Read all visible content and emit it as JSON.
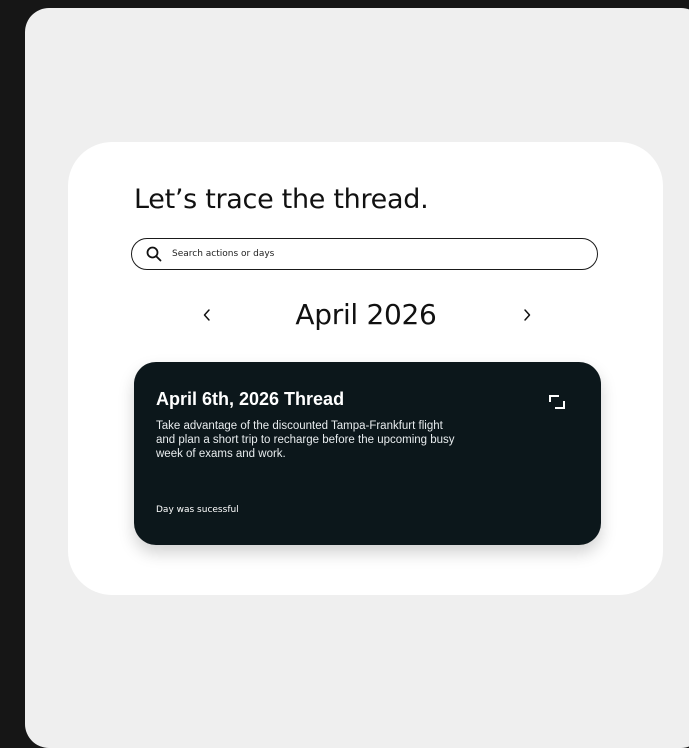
{
  "heading": "Let’s trace the thread.",
  "search": {
    "placeholder": "Search actions or days",
    "icon": "search-icon"
  },
  "calendar": {
    "month_label": "April 2026",
    "prev_icon": "chevron-left-icon",
    "next_icon": "chevron-right-icon"
  },
  "thread": {
    "title": "April 6th, 2026 Thread",
    "description": "Take advantage of the discounted Tampa-Frankfurt flight and plan a short trip to recharge before the upcoming busy week of exams and work.",
    "status": "Day was sucessful",
    "expand_icon": "expand-icon"
  },
  "colors": {
    "page_background": "#161616",
    "panel_background": "#efefef",
    "card_background": "#ffffff",
    "thread_card_background": "#0c171b",
    "text_primary": "#111111",
    "text_on_dark": "#ffffff"
  }
}
